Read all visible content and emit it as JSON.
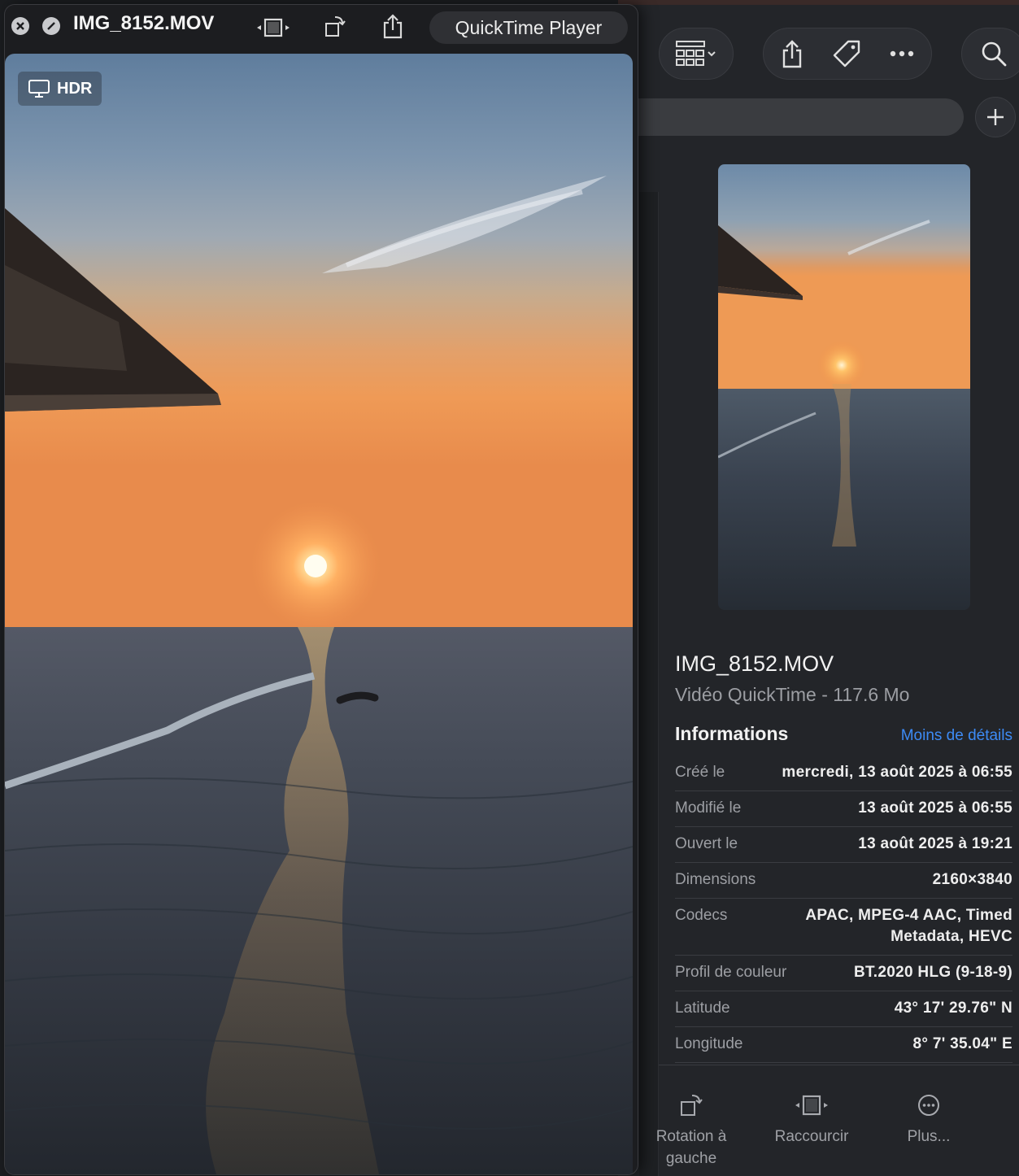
{
  "quicktime": {
    "title": "IMG_8152.MOV",
    "app_name": "QuickTime Player",
    "hdr_badge": "HDR"
  },
  "finder": {
    "file_name": "IMG_8152.MOV",
    "file_type": "Vidéo QuickTime - 117.6 Mo",
    "section_title": "Informations",
    "less_details_link": "Moins de détails",
    "info_rows": [
      {
        "key": "Créé le",
        "value": "mercredi, 13 août 2025 à 06:55"
      },
      {
        "key": "Modifié le",
        "value": "13 août 2025 à 06:55"
      },
      {
        "key": "Ouvert le",
        "value": "13 août 2025 à 19:21"
      },
      {
        "key": "Dimensions",
        "value": "2160×3840"
      },
      {
        "key": "Codecs",
        "value": "APAC, MPEG-4 AAC, Timed Metadata, HEVC"
      },
      {
        "key": "Profil de couleur",
        "value": "BT.2020 HLG (9-18-9)"
      },
      {
        "key": "Latitude",
        "value": "43° 17' 29.76\" N"
      },
      {
        "key": "Longitude",
        "value": "8° 7' 35.04\" E"
      }
    ],
    "actions": [
      {
        "label": "Rotation à gauche"
      },
      {
        "label": "Raccourcir"
      },
      {
        "label": "Plus..."
      }
    ]
  },
  "icons": {
    "close": "close-icon",
    "disabled": "minimize-disabled-icon",
    "trim": "trim-icon",
    "rotate": "rotate-left-icon",
    "share": "share-icon",
    "view": "gallery-view-icon",
    "tag": "tag-icon",
    "more": "ellipsis-icon",
    "search": "search-icon",
    "add": "plus-icon",
    "display": "display-icon"
  },
  "colors": {
    "link": "#3d8bf5",
    "background": "#232529"
  }
}
